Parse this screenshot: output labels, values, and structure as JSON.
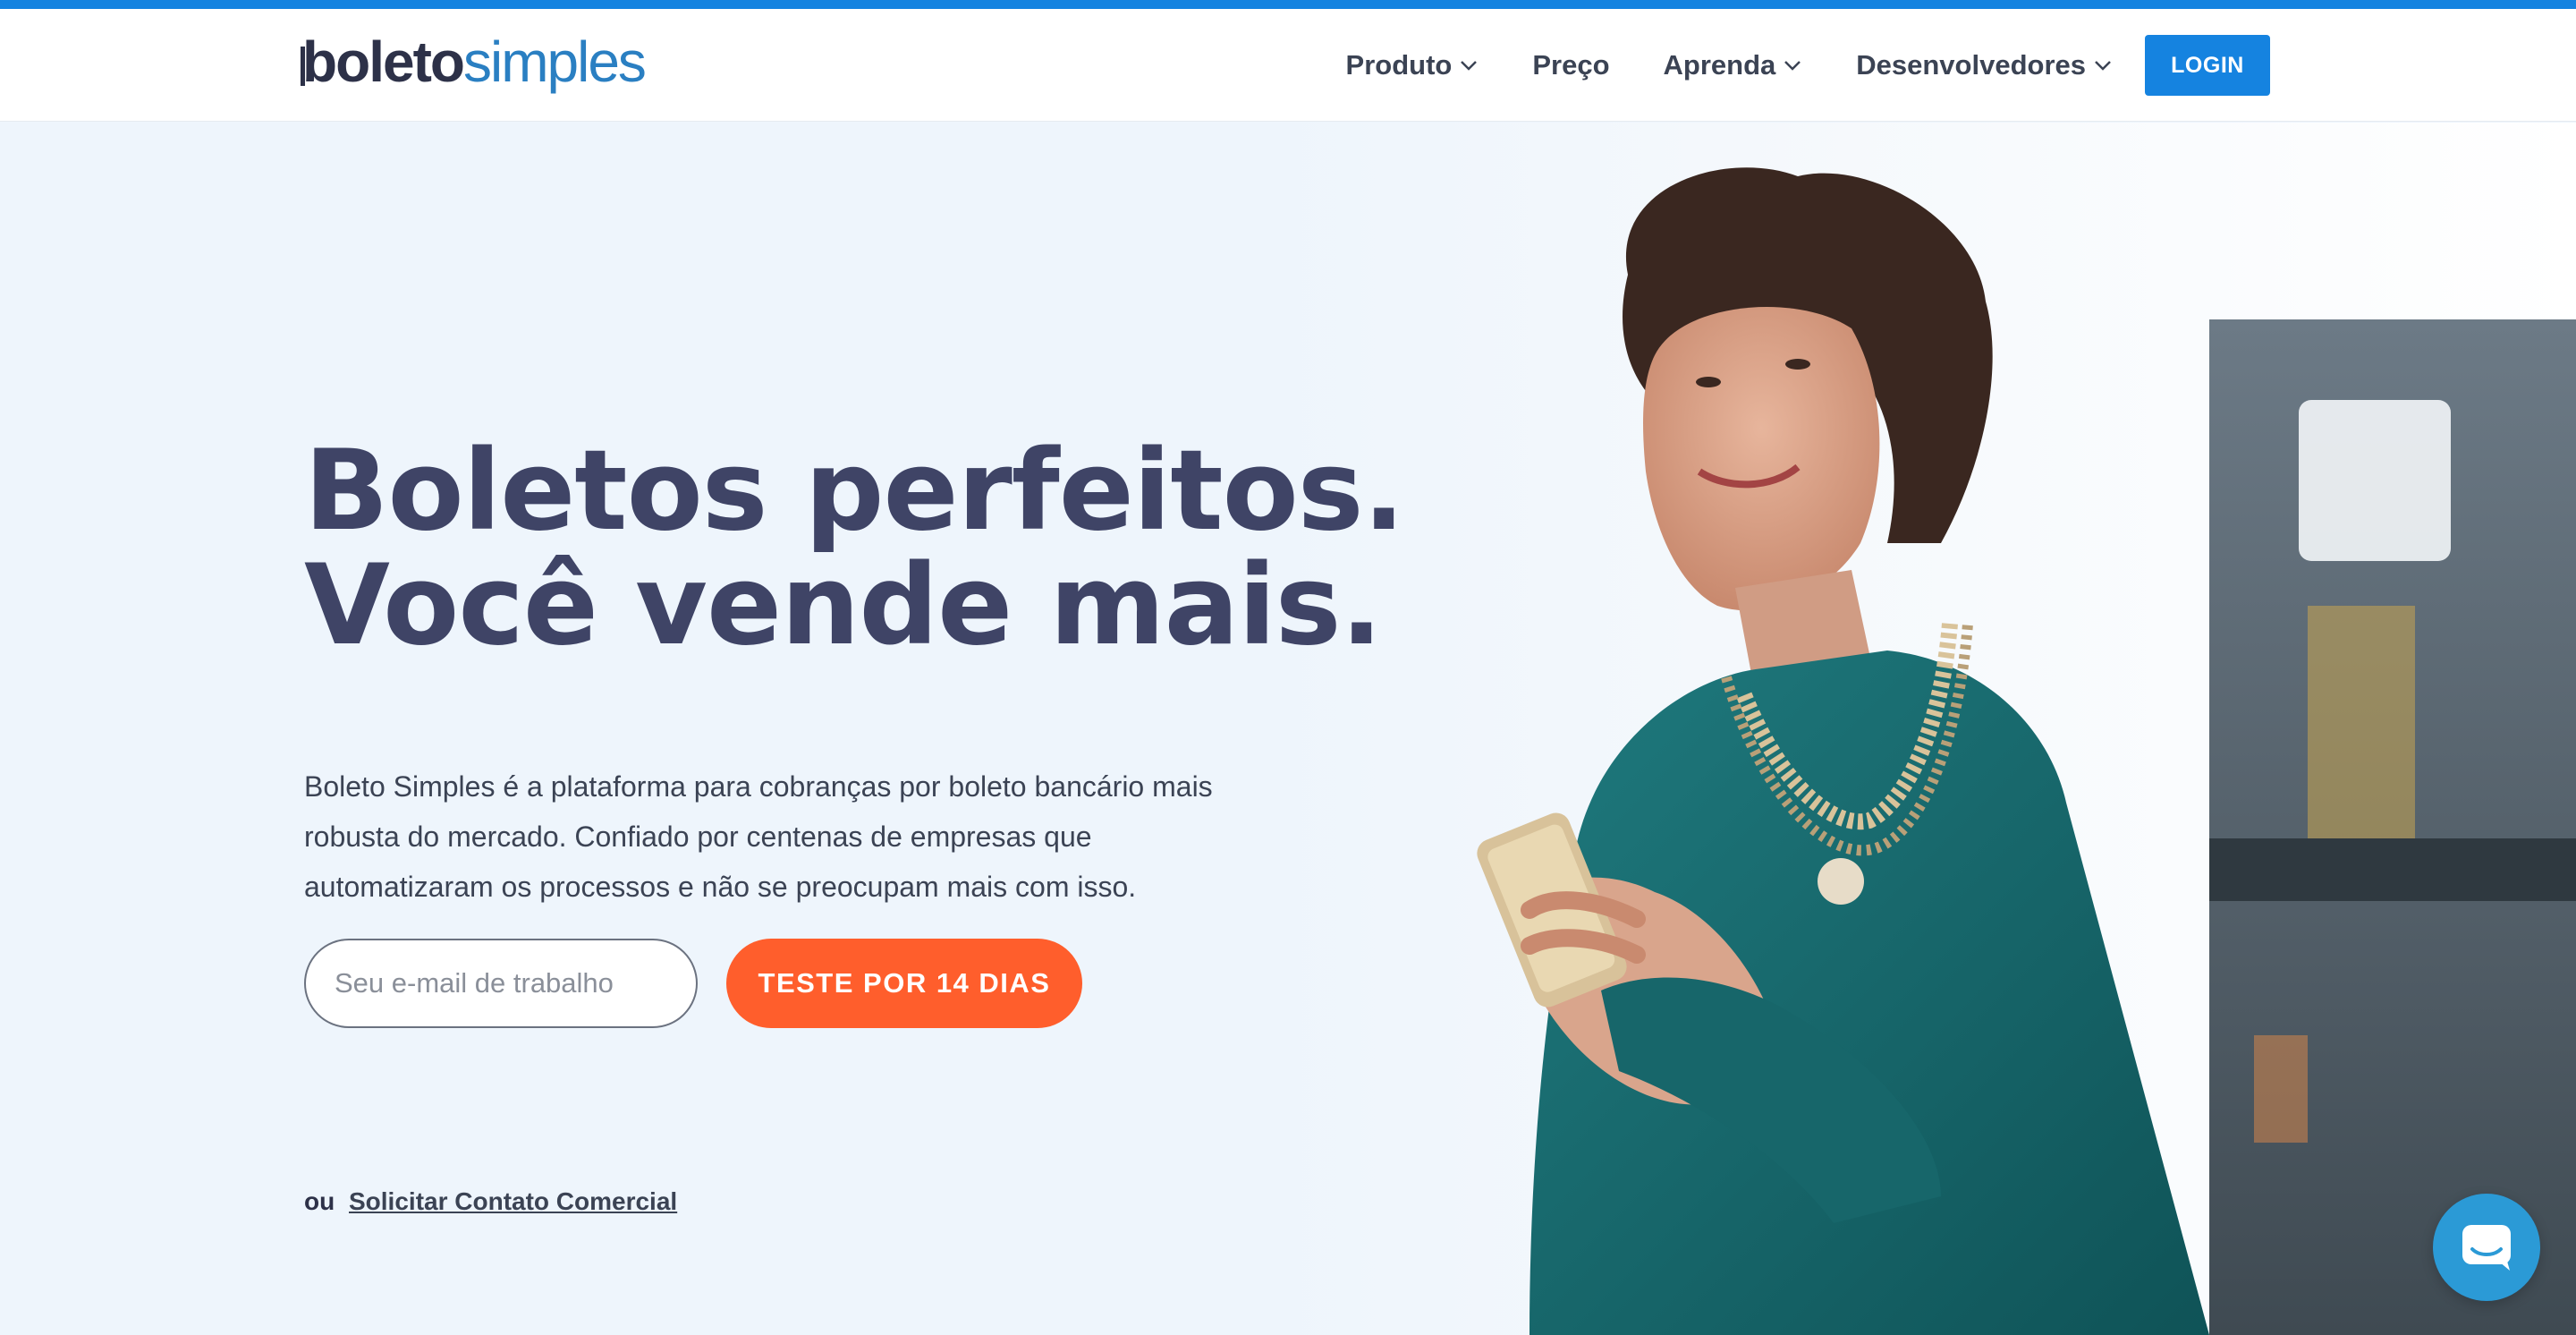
{
  "colors": {
    "accent": "#1583e0",
    "cta": "#ff5e2c",
    "heading": "#3f4466",
    "hero_bg": "#eef5fc"
  },
  "header": {
    "logo_part1": "boleto",
    "logo_part2": "simples",
    "nav": [
      {
        "label": "Produto",
        "has_dropdown": true
      },
      {
        "label": "Preço",
        "has_dropdown": false
      },
      {
        "label": "Aprenda",
        "has_dropdown": true
      },
      {
        "label": "Desenvolvedores",
        "has_dropdown": true
      }
    ],
    "login_label": "LOGIN"
  },
  "hero": {
    "headline_line1": "Boletos perfeitos.",
    "headline_line2": "Você vende mais.",
    "description": "Boleto Simples é a plataforma para cobranças por boleto bancário mais robusta do mercado. Confiado por centenas de empresas que automatizaram os processos e não se preocupam mais com isso.",
    "email_placeholder": "Seu e-mail de trabalho",
    "email_value": "",
    "trial_button": "TESTE POR 14 DIAS",
    "or_text": "ou",
    "contact_link": "Solicitar Contato Comercial"
  },
  "chat": {
    "icon": "chat-icon"
  }
}
